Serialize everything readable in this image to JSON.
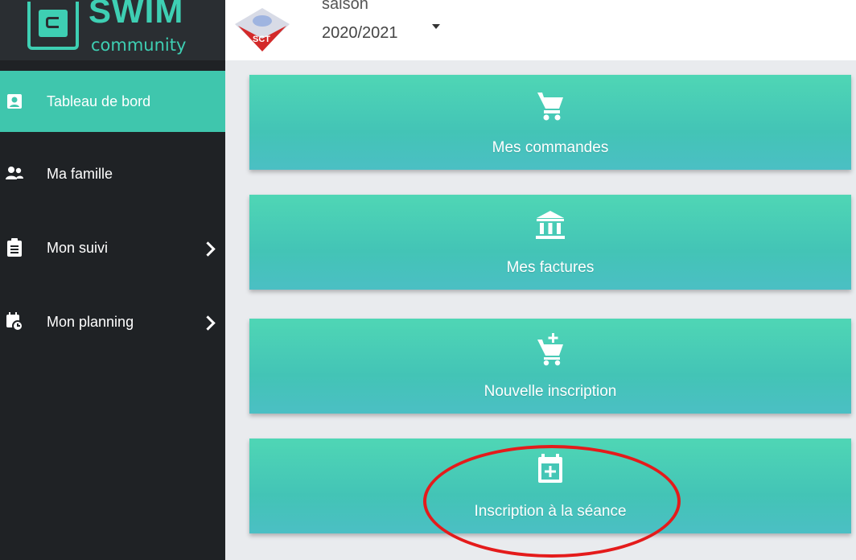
{
  "brand": {
    "name": "SWIM",
    "tagline": "community",
    "accent_color": "#3ecfb3"
  },
  "header": {
    "club_logo_text": "SCT",
    "season_label": "saison",
    "season_value": "2020/2021"
  },
  "sidebar": {
    "items": [
      {
        "label": "Tableau de bord",
        "icon": "badge-icon",
        "active": true
      },
      {
        "label": "Ma famille",
        "icon": "people-icon",
        "active": false
      },
      {
        "label": "Mon suivi",
        "icon": "clipboard-icon",
        "active": false,
        "has_submenu": true
      },
      {
        "label": "Mon planning",
        "icon": "calendar-clock-icon",
        "active": false,
        "has_submenu": true
      }
    ]
  },
  "main": {
    "tiles": [
      {
        "label": "Mes commandes",
        "icon": "cart-icon"
      },
      {
        "label": "Mes factures",
        "icon": "bank-icon"
      },
      {
        "label": "Nouvelle inscription",
        "icon": "cart-plus-icon"
      },
      {
        "label": "Inscription à la séance",
        "icon": "calendar-plus-icon",
        "highlighted": true
      }
    ]
  },
  "colors": {
    "sidebar_bg": "#1f2225",
    "active_item": "#3fc6ad",
    "tile": "#46c8b4",
    "annotation": "#e41b1b"
  }
}
